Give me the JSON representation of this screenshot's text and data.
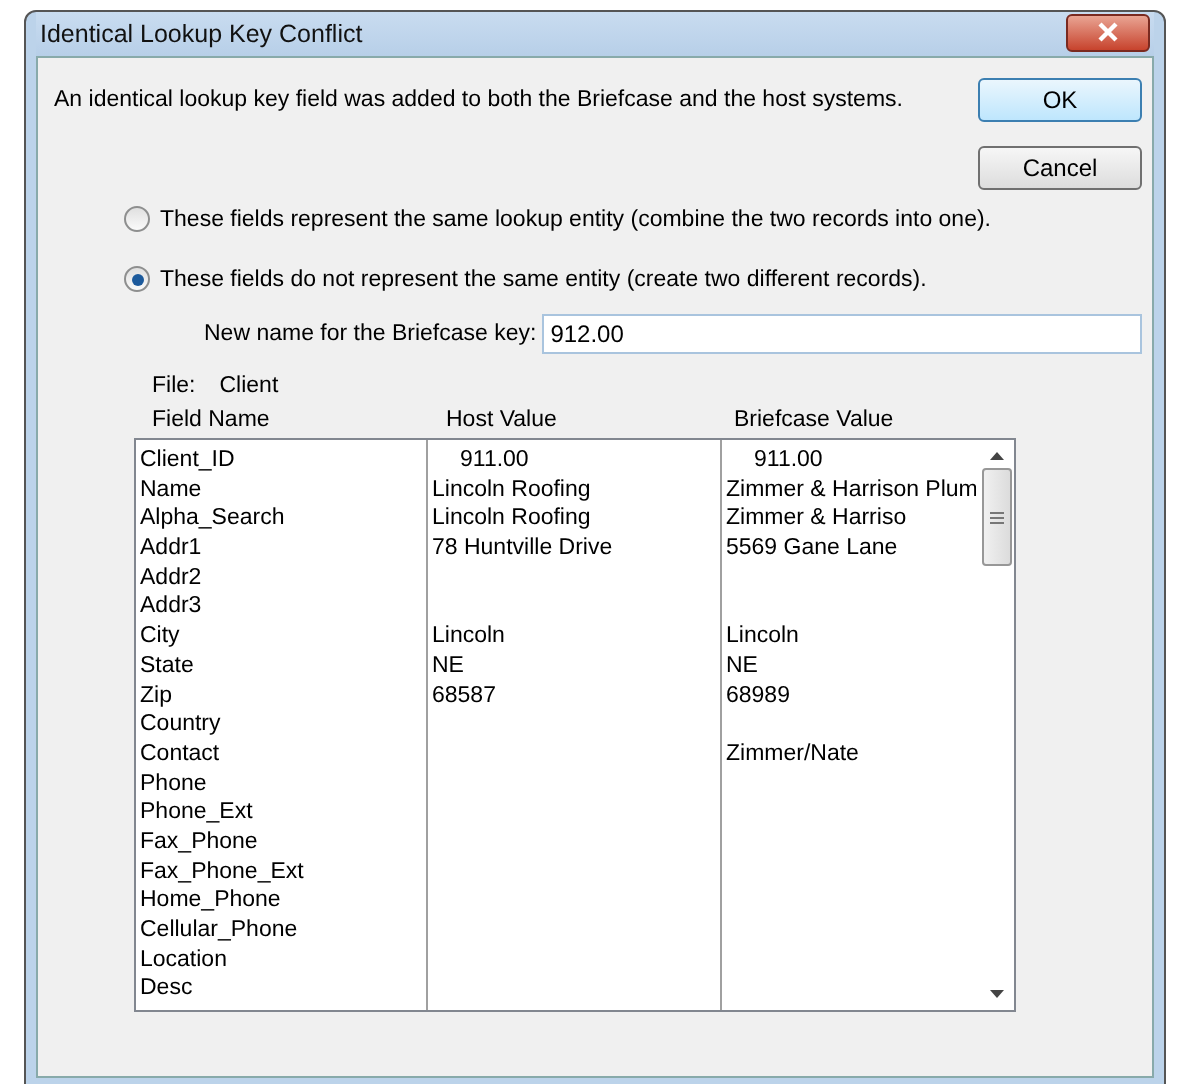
{
  "window": {
    "title": "Identical Lookup Key Conflict"
  },
  "message": "An identical lookup key field was added to both the Briefcase and the host systems.",
  "buttons": [
    {
      "label": "OK",
      "default": true
    },
    {
      "label": "Cancel",
      "default": false
    }
  ],
  "options": [
    {
      "label": "These fields represent the same lookup entity (combine the two records into one).",
      "selected": false
    },
    {
      "label": "These fields do not represent the same entity (create two different records).",
      "selected": true
    }
  ],
  "new_name": {
    "label": "New name for the Briefcase key:",
    "value": "912.00"
  },
  "file": {
    "label": "File:",
    "value": "Client"
  },
  "table": {
    "columns": [
      "Field Name",
      "Host Value",
      "Briefcase Value"
    ],
    "rows": [
      [
        "Client_ID",
        "911.00",
        "911.00"
      ],
      [
        "Name",
        "Lincoln Roofing",
        "Zimmer & Harrison Plum"
      ],
      [
        "Alpha_Search",
        "Lincoln Roofing",
        "Zimmer & Harriso"
      ],
      [
        "Addr1",
        "78 Huntville Drive",
        "5569 Gane Lane"
      ],
      [
        "Addr2",
        "",
        ""
      ],
      [
        "Addr3",
        "",
        ""
      ],
      [
        "City",
        "Lincoln",
        "Lincoln"
      ],
      [
        "State",
        "NE",
        "NE"
      ],
      [
        "Zip",
        "68587",
        "68989"
      ],
      [
        "Country",
        "",
        ""
      ],
      [
        "Contact",
        "",
        "Zimmer/Nate"
      ],
      [
        "Phone",
        "",
        ""
      ],
      [
        "Phone_Ext",
        "",
        ""
      ],
      [
        "Fax_Phone",
        "",
        ""
      ],
      [
        "Fax_Phone_Ext",
        "",
        ""
      ],
      [
        "Home_Phone",
        "",
        ""
      ],
      [
        "Cellular_Phone",
        "",
        ""
      ],
      [
        "Location",
        "",
        ""
      ],
      [
        "Desc",
        "",
        ""
      ]
    ]
  }
}
